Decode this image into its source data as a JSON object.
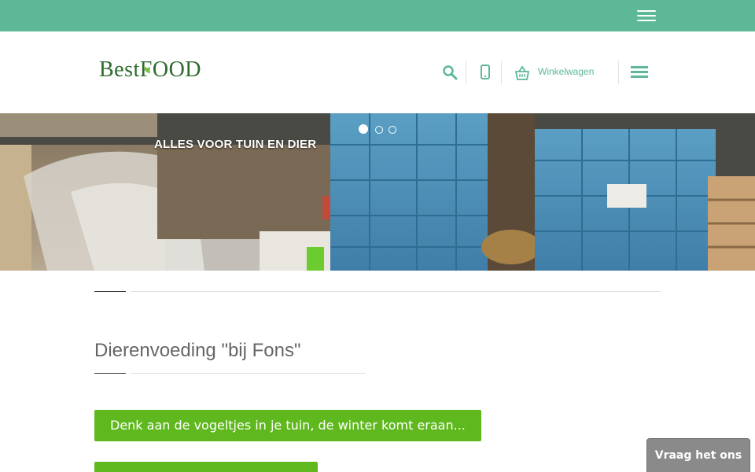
{
  "topbar": {
    "color": "#5cb896",
    "menu_icon": "hamburger-icon"
  },
  "header": {
    "logo_text": "BestFOOD",
    "search_icon": "search-icon",
    "phone_icon": "phone-icon",
    "cart_icon": "basket-icon",
    "cart_label": "Winkelwagen",
    "menu_icon": "hamburger-icon",
    "accent_color": "#5cb896"
  },
  "hero": {
    "caption": "ALLES VOOR TUIN EN DIER",
    "slides": [
      {
        "active": true
      },
      {
        "active": false
      },
      {
        "active": false
      }
    ]
  },
  "main": {
    "title": "Dierenvoeding \"bij Fons\"",
    "buttons": [
      {
        "label": "Denk aan de vogeltjes in je tuin, de winter komt eraan..."
      },
      {
        "label": ""
      }
    ],
    "button_color": "#5fb81e"
  },
  "chat": {
    "label": "Vraag het ons"
  }
}
